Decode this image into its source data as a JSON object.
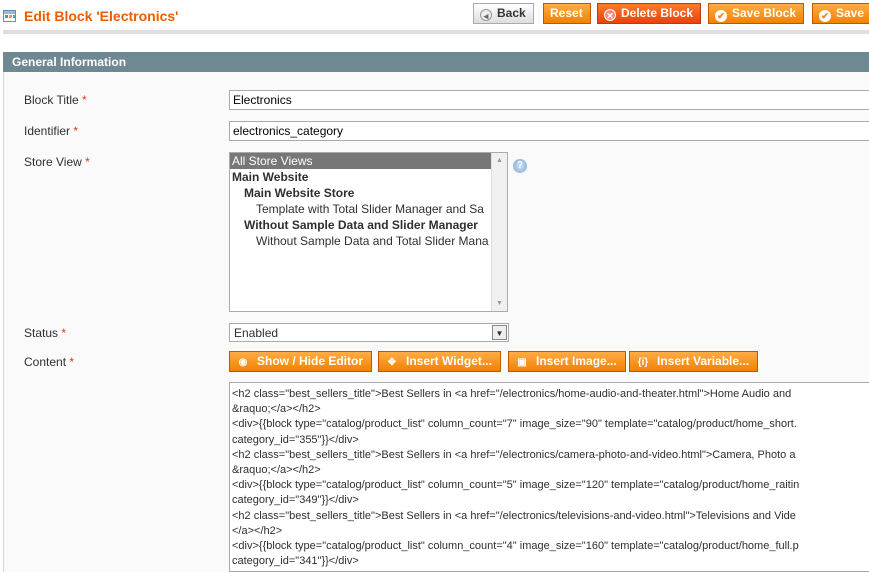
{
  "header": {
    "title": "Edit Block 'Electronics'",
    "buttons": {
      "back": "Back",
      "reset": "Reset",
      "delete": "Delete Block",
      "save_block": "Save Block",
      "save": "Save"
    }
  },
  "section": {
    "title": "General Information"
  },
  "fields": {
    "block_title": {
      "label": "Block Title",
      "required": "*",
      "value": "Electronics"
    },
    "identifier": {
      "label": "Identifier",
      "required": "*",
      "value": "electronics_category"
    },
    "store_view": {
      "label": "Store View",
      "required": "*",
      "options": [
        "All Store Views",
        "Main Website",
        "Main Website Store",
        "Template with Total Slider Manager and Sa",
        "Without Sample Data and Slider Manager",
        "Without Sample Data and Total Slider Mana"
      ],
      "selected": "All Store Views"
    },
    "status": {
      "label": "Status",
      "required": "*",
      "value": "Enabled"
    },
    "content": {
      "label": "Content",
      "required": "*",
      "buttons": {
        "show_hide": "Show / Hide Editor",
        "insert_widget": "Insert Widget...",
        "insert_image": "Insert Image...",
        "insert_variable": "Insert Variable..."
      },
      "lines": [
        "<h2 class=\"best_sellers_title\">Best Sellers in  <a href=\"/electronics/home-audio-and-theater.html\">Home Audio and",
        "&raquo;</a></h2>",
        "<div>{{block type=\"catalog/product_list\"  column_count=\"7\"  image_size=\"90\" template=\"catalog/product/home_short.",
        "category_id=\"355\"}}</div>",
        "<h2 class=\"best_sellers_title\">Best Sellers in  <a href=\"/electronics/camera-photo-and-video.html\">Camera, Photo a",
        "&raquo;</a></h2>",
        "<div>{{block type=\"catalog/product_list\"  column_count=\"5\"  image_size=\"120\" template=\"catalog/product/home_raitin",
        "category_id=\"349\"}}</div>",
        "<h2 class=\"best_sellers_title\">Best Sellers in  <a href=\"/electronics/televisions-and-video.html\">Televisions and Vide",
        "</a></h2>",
        "<div>{{block type=\"catalog/product_list\"  column_count=\"4\"  image_size=\"160\" template=\"catalog/product/home_full.p",
        "category_id=\"341\"}}</div>"
      ]
    }
  },
  "colors": {
    "accent": "#eb5e00",
    "button": "#f18200",
    "section_header": "#6f8992"
  }
}
